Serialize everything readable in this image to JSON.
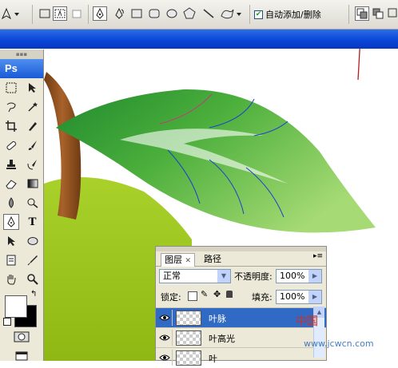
{
  "options_bar": {
    "auto_add_delete_label": "自动添加/删除",
    "auto_add_delete_checked": true
  },
  "toolbox": {
    "logo_text": "Ps",
    "text_tool_glyph": "T"
  },
  "layers_panel": {
    "tabs": [
      {
        "label": "图层"
      },
      {
        "label": "路径"
      }
    ],
    "blend_mode": "正常",
    "opacity_label": "不透明度:",
    "opacity_value": "100%",
    "lock_label": "锁定:",
    "fill_label": "填充:",
    "fill_value": "100%",
    "layers": [
      {
        "name": "叶脉",
        "selected": true
      },
      {
        "name": "叶高光",
        "selected": false
      },
      {
        "name": "叶",
        "selected": false
      }
    ]
  },
  "watermark": {
    "line1": "中国",
    "line2": "www.jcwcn.com"
  },
  "colors": {
    "titlebar": "#0a46d8",
    "selection": "#316ac5",
    "annotation_arrow": "#b51d1d",
    "leaf_dark": "#2f9a3a",
    "leaf_light": "#9fd76a",
    "apple": "#9cc51c",
    "stem": "#8a4a1a"
  }
}
